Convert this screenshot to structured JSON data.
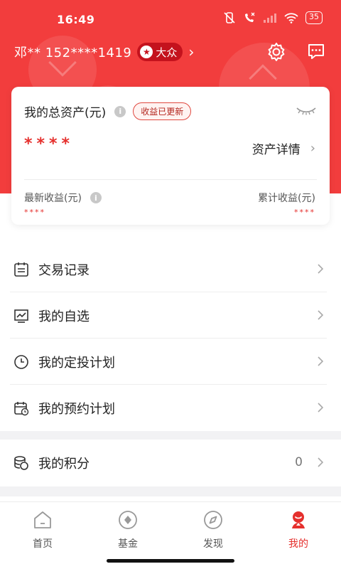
{
  "status_bar": {
    "time": "16:49",
    "battery": "35"
  },
  "account": {
    "name": "邓** 152****1419",
    "level": "大众"
  },
  "asset_card": {
    "title": "我的总资产(元)",
    "updated_badge": "收益已更新",
    "total_masked": "****",
    "detail_link": "资产详情",
    "latest_label": "最新收益(元)",
    "latest_value": "****",
    "cumulative_label": "累计收益(元)",
    "cumulative_value": "****"
  },
  "menu": [
    {
      "label": "交易记录",
      "icon": "list-icon"
    },
    {
      "label": "我的自选",
      "icon": "chart-icon"
    },
    {
      "label": "我的定投计划",
      "icon": "clock-icon"
    },
    {
      "label": "我的预约计划",
      "icon": "calendar-icon"
    }
  ],
  "points": {
    "label": "我的积分",
    "value": "0",
    "icon": "coins-icon"
  },
  "tabs": [
    {
      "label": "首页",
      "icon": "home-icon"
    },
    {
      "label": "基金",
      "icon": "fund-icon"
    },
    {
      "label": "发现",
      "icon": "compass-icon"
    },
    {
      "label": "我的",
      "icon": "profile-icon",
      "active": true
    }
  ],
  "colors": {
    "brand_red": "#f23d3d",
    "accent_red": "#e5302d"
  }
}
